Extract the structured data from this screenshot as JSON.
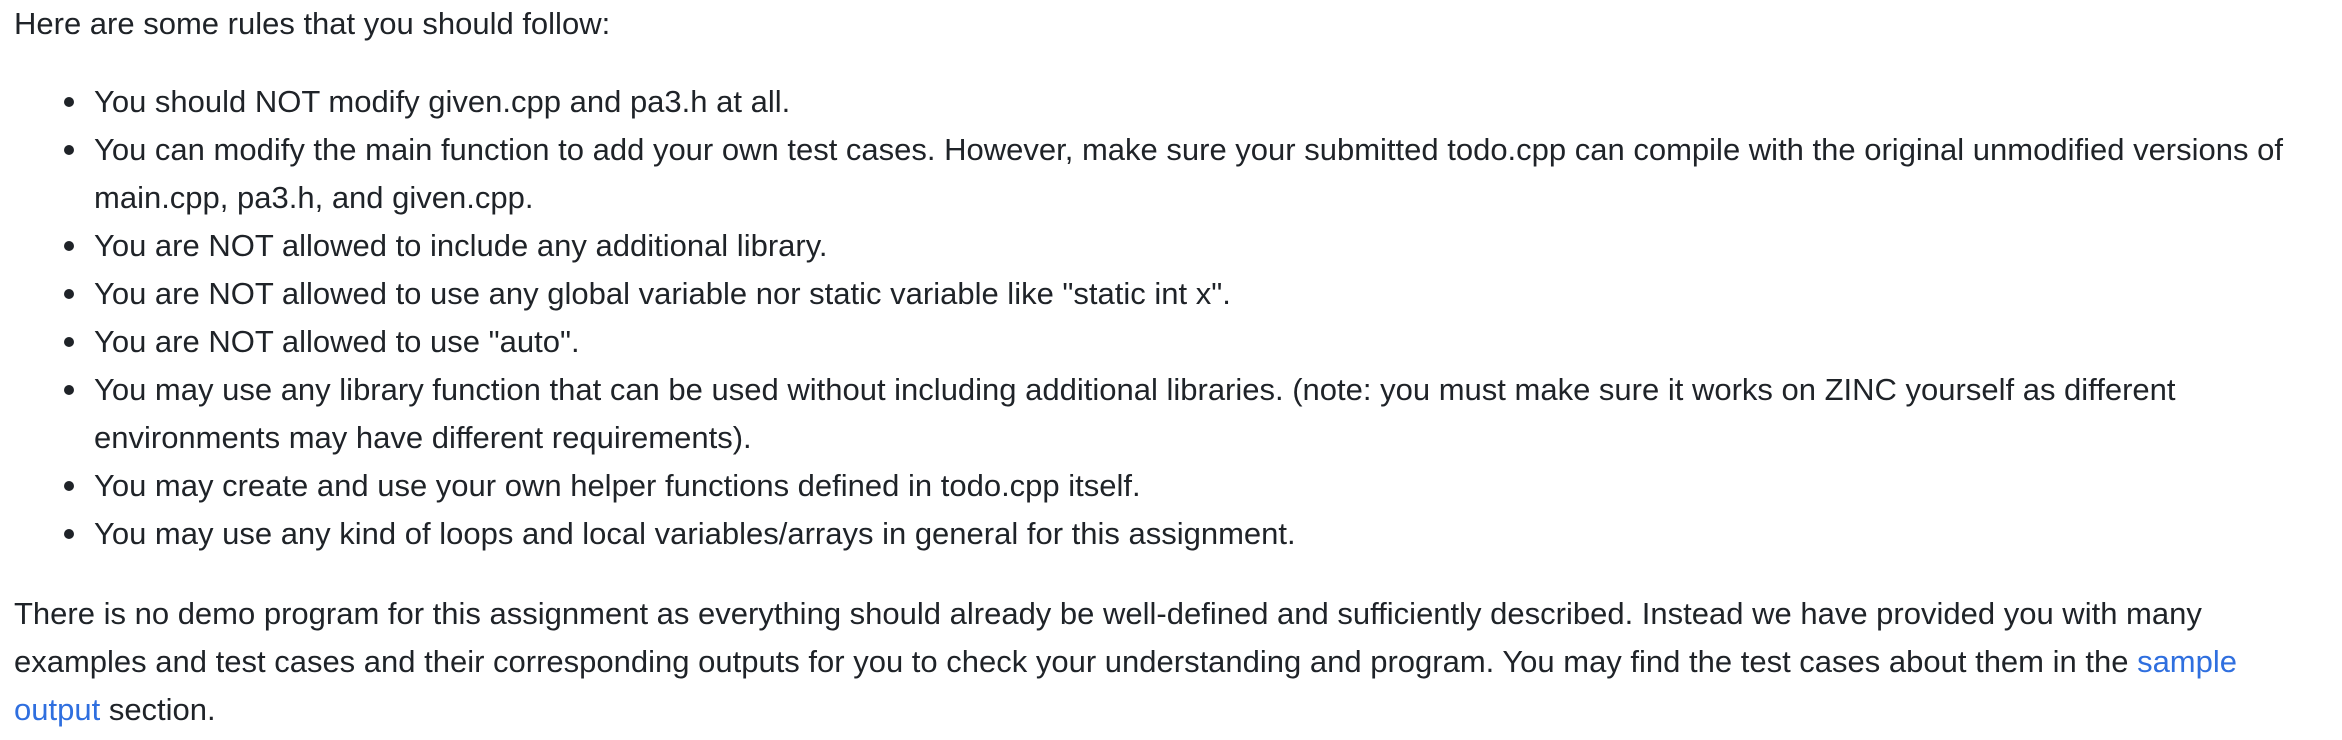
{
  "intro": "Here are some rules that you should follow:",
  "rules": [
    "You should NOT modify given.cpp and pa3.h at all.",
    "You can modify the main function to add your own test cases. However, make sure your submitted todo.cpp can compile with the original unmodified versions of main.cpp, pa3.h, and given.cpp.",
    "You are NOT allowed to include any additional library.",
    "You are NOT allowed to use any global variable nor static variable like \"static int x\".",
    "You are NOT allowed to use \"auto\".",
    "You may use any library function that can be used without including additional libraries. (note: you must make sure it works on ZINC yourself as different environments may have different requirements).",
    "You may create and use your own helper functions defined in todo.cpp itself.",
    "You may use any kind of loops and local variables/arrays in general for this assignment."
  ],
  "outro": {
    "text": "There is no demo program for this assignment as everything should already be well-defined and sufficiently described. Instead we have provided you with many examples and test cases and their corresponding outputs for you to check your understanding and program. You may find the test cases about them in the ",
    "link_text": "sample output",
    "suffix": " section."
  }
}
